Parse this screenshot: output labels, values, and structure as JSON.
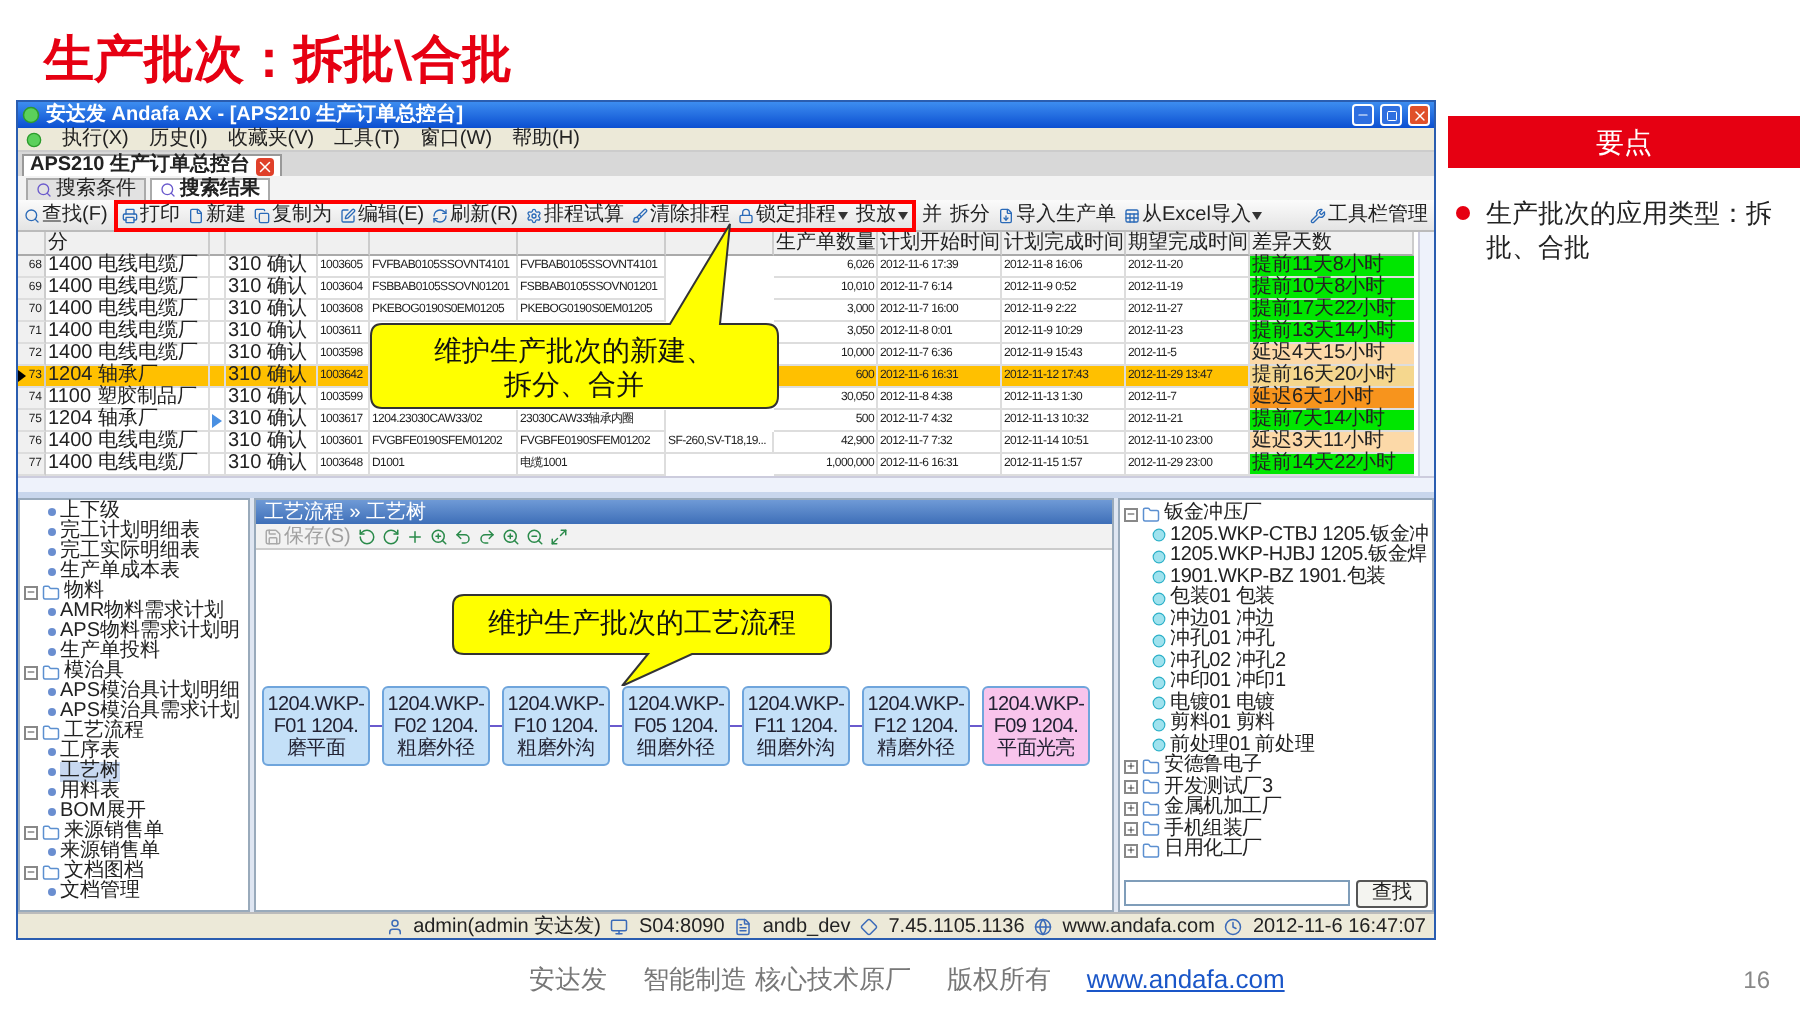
{
  "title": "生产批次：拆批\\合批",
  "app": {
    "window_title": "安达发 Andafa AX - [APS210 生产订单总控台]",
    "menu": [
      "执行(X)",
      "历史(I)",
      "收藏夹(V)",
      "工具(T)",
      "窗口(W)",
      "帮助(H)"
    ],
    "document_tab": "APS210 生产订单总控台",
    "subtabs": [
      {
        "label": "搜索条件",
        "selected": false
      },
      {
        "label": "搜索结果",
        "selected": true
      }
    ],
    "toolbar": [
      {
        "label": "查找(F)",
        "highlighted": false,
        "dropdown": false
      },
      {
        "label": "打印",
        "highlighted": true,
        "dropdown": false
      },
      {
        "label": "新建",
        "highlighted": true,
        "dropdown": false
      },
      {
        "label": "复制为",
        "highlighted": true,
        "dropdown": false
      },
      {
        "label": "编辑(E)",
        "highlighted": true,
        "dropdown": false
      },
      {
        "label": "刷新(R)",
        "highlighted": true,
        "dropdown": false
      },
      {
        "label": "排程试算",
        "highlighted": true,
        "dropdown": false
      },
      {
        "label": "清除排程",
        "highlighted": true,
        "dropdown": false
      },
      {
        "label": "锁定排程",
        "highlighted": true,
        "dropdown": true
      },
      {
        "label": "投放",
        "highlighted": true,
        "dropdown": true
      },
      {
        "label": "并",
        "highlighted": false,
        "dropdown": false
      },
      {
        "label": "拆分",
        "highlighted": false,
        "dropdown": false
      },
      {
        "label": "导入生产单",
        "highlighted": false,
        "dropdown": false
      },
      {
        "label": "从Excel导入",
        "highlighted": false,
        "dropdown": true
      }
    ],
    "toolbar_right": "工具栏管理",
    "callout_top": [
      "维护生产批次的新建、",
      "拆分、合并"
    ],
    "table": {
      "columns": [
        "分",
        null,
        null,
        null,
        null,
        null,
        null,
        "生产单数量",
        "计划开始时间",
        "计划完成时间",
        "期望完成时间",
        "差异天数"
      ],
      "rows": [
        {
          "number": "68",
          "selected": false,
          "flag": false,
          "cells": [
            "1400 电线电缆厂",
            null,
            "310 确认",
            "1003605",
            "FVFBAB0105SSOVNT4101",
            "FVFBAB0105SSOVNT4101",
            null,
            "6,026",
            "2012-11-6 17:39",
            "2012-11-8 16:06",
            "2012-11-20"
          ],
          "variance": "提前11天8小时",
          "color": "#00e600"
        },
        {
          "number": "69",
          "selected": false,
          "flag": false,
          "cells": [
            "1400 电线电缆厂",
            null,
            "310 确认",
            "1003604",
            "FSBBAB0105SSOVN01201",
            "FSBBAB0105SSOVN01201",
            null,
            "10,010",
            "2012-11-7 6:14",
            "2012-11-9 0:52",
            "2012-11-19"
          ],
          "variance": "提前10天8小时",
          "color": "#00e600"
        },
        {
          "number": "70",
          "selected": false,
          "flag": false,
          "cells": [
            "1400 电线电缆厂",
            null,
            "310 确认",
            "1003608",
            "PKEBOG0190S0EM01205",
            "PKEBOG0190S0EM01205",
            null,
            "3,000",
            "2012-11-7 16:00",
            "2012-11-9 2:22",
            "2012-11-27"
          ],
          "variance": "提前17天22小时",
          "color": "#00e600"
        },
        {
          "number": "71",
          "selected": false,
          "flag": false,
          "cells": [
            "1400 电线电缆厂",
            null,
            "310 确认",
            "1003611",
            null,
            null,
            null,
            "3,050",
            "2012-11-8 0:01",
            "2012-11-9 10:29",
            "2012-11-23"
          ],
          "variance": "提前13天14小时",
          "color": "#00e600"
        },
        {
          "number": "72",
          "selected": false,
          "flag": false,
          "cells": [
            "1400 电线电缆厂",
            null,
            "310 确认",
            "1003598",
            null,
            null,
            null,
            "10,000",
            "2012-11-7 6:36",
            "2012-11-9 15:43",
            "2012-11-5"
          ],
          "variance": "延迟4天15小时",
          "color": "#fcd9a8"
        },
        {
          "number": "73",
          "selected": true,
          "flag": false,
          "cells": [
            "1204 轴承厂",
            null,
            "310 确认",
            "1003642",
            null,
            null,
            null,
            "600",
            "2012-11-6 16:31",
            "2012-11-12 17:43",
            "2012-11-29 13:47"
          ],
          "variance": "提前16天20小时",
          "color": "#f5d78e"
        },
        {
          "number": "74",
          "selected": false,
          "flag": false,
          "cells": [
            "1100 塑胶制品厂",
            null,
            "310 确认",
            "1003599",
            null,
            null,
            null,
            "30,050",
            "2012-11-8 4:38",
            "2012-11-13 1:30",
            "2012-11-7"
          ],
          "variance": "延迟6天1小时",
          "color": "#f7941d"
        },
        {
          "number": "75",
          "selected": false,
          "flag": true,
          "cells": [
            "1204 轴承厂",
            null,
            "310 确认",
            "1003617",
            "1204.23030CAW33/02",
            "23030CAW33轴承内圈",
            null,
            "500",
            "2012-11-7 4:32",
            "2012-11-13 10:32",
            "2012-11-21"
          ],
          "variance": "提前7天14小时",
          "color": "#00e600"
        },
        {
          "number": "76",
          "selected": false,
          "flag": false,
          "cells": [
            "1400 电线电缆厂",
            null,
            "310 确认",
            "1003601",
            "FVGBFE0190SFEM01202",
            "FVGBFE0190SFEM01202",
            "SF-260,SV-T18,19...",
            "42,900",
            "2012-11-7 7:32",
            "2012-11-14 10:51",
            "2012-11-10 23:00"
          ],
          "variance": "延迟3天11小时",
          "color": "#fcd9a8"
        },
        {
          "number": "77",
          "selected": false,
          "flag": false,
          "cells": [
            "1400 电线电缆厂",
            null,
            "310 确认",
            "1003648",
            "D1001",
            "电缆1001",
            null,
            "1,000,000",
            "2012-11-6 16:31",
            "2012-11-15 1:57",
            "2012-11-29 23:00"
          ],
          "variance": "提前14天22小时",
          "color": "#00e600"
        }
      ]
    },
    "left_tree": [
      {
        "label": "上下级",
        "selected": false
      },
      {
        "label": "完工计划明细表",
        "selected": false
      },
      {
        "label": "完工实际明细表",
        "selected": false
      },
      {
        "label": "生产单成本表",
        "selected": false
      },
      {
        "label": "物料",
        "expanded": true,
        "children": [
          {
            "label": "AMR物料需求计划",
            "selected": false
          },
          {
            "label": "APS物料需求计划明",
            "selected": false
          },
          {
            "label": "生产单投料",
            "selected": false
          }
        ]
      },
      {
        "label": "模治具",
        "expanded": true,
        "children": [
          {
            "label": "APS模治具计划明细",
            "selected": false
          },
          {
            "label": "APS模治具需求计划",
            "selected": false
          }
        ]
      },
      {
        "label": "工艺流程",
        "expanded": true,
        "children": [
          {
            "label": "工序表",
            "selected": false
          },
          {
            "label": "工艺树",
            "selected": true
          },
          {
            "label": "用料表",
            "selected": false
          },
          {
            "label": "BOM展开",
            "selected": false
          }
        ]
      },
      {
        "label": "来源销售单",
        "expanded": true,
        "children": [
          {
            "label": "来源销售单",
            "selected": false
          }
        ]
      },
      {
        "label": "文档图档",
        "expanded": true,
        "children": [
          {
            "label": "文档管理",
            "selected": false
          }
        ]
      }
    ],
    "process": {
      "header": "工艺流程 » 工艺树",
      "save": {
        "label": "保存(S)",
        "disabled": true
      },
      "callout": "维护生产批次的工艺流程",
      "nodes": [
        {
          "label": "1204.WKP-F01 1204.磨平面",
          "color": "#c4e0f8"
        },
        {
          "label": "1204.WKP-F02 1204.粗磨外径",
          "color": "#c4e0f8"
        },
        {
          "label": "1204.WKP-F10 1204.粗磨外沟",
          "color": "#c4e0f8"
        },
        {
          "label": "1204.WKP-F05 1204.细磨外径",
          "color": "#c4e0f8"
        },
        {
          "label": "1204.WKP-F11 1204.细磨外沟",
          "color": "#c4e0f8"
        },
        {
          "label": "1204.WKP-F12 1204.精磨外径",
          "color": "#c4e0f8"
        },
        {
          "label": "1204.WKP-F09 1204.平面光亮",
          "color": "#f8c4ec"
        }
      ]
    },
    "right_tree": [
      {
        "label": "钣金冲压厂",
        "expanded": true,
        "children": [
          {
            "label": "1205.WKP-CTBJ 1205.钣金冲"
          },
          {
            "label": "1205.WKP-HJBJ 1205.钣金焊"
          },
          {
            "label": "1901.WKP-BZ 1901.包装"
          },
          {
            "label": "包装01 包装"
          },
          {
            "label": "冲边01 冲边"
          },
          {
            "label": "冲孔01 冲孔"
          },
          {
            "label": "冲孔02 冲孔2"
          },
          {
            "label": "冲印01 冲印1"
          },
          {
            "label": "电镀01 电镀"
          },
          {
            "label": "剪料01 剪料"
          },
          {
            "label": "前处理01 前处理"
          }
        ]
      },
      {
        "label": "安德鲁电子",
        "expanded": false
      },
      {
        "label": "开发测试厂3",
        "expanded": false
      },
      {
        "label": "金属机加工厂",
        "expanded": false
      },
      {
        "label": "手机组装厂",
        "expanded": false
      },
      {
        "label": "日用化工厂",
        "expanded": false
      }
    ],
    "find_button": "查找",
    "status_bar": [
      "admin(admin 安达发)",
      "S04:8090",
      "andb_dev",
      "7.45.1105.1136",
      "www.andafa.com",
      "2012-11-6 16:47:07"
    ]
  },
  "key_points": {
    "heading": "要点",
    "bullets": [
      "生产批次的应用类型：拆批、合批"
    ]
  },
  "footer": {
    "texts": [
      "安达发",
      "智能制造 核心技术原厂",
      "版权所有"
    ],
    "link": "www.andafa.com",
    "page": "16"
  }
}
